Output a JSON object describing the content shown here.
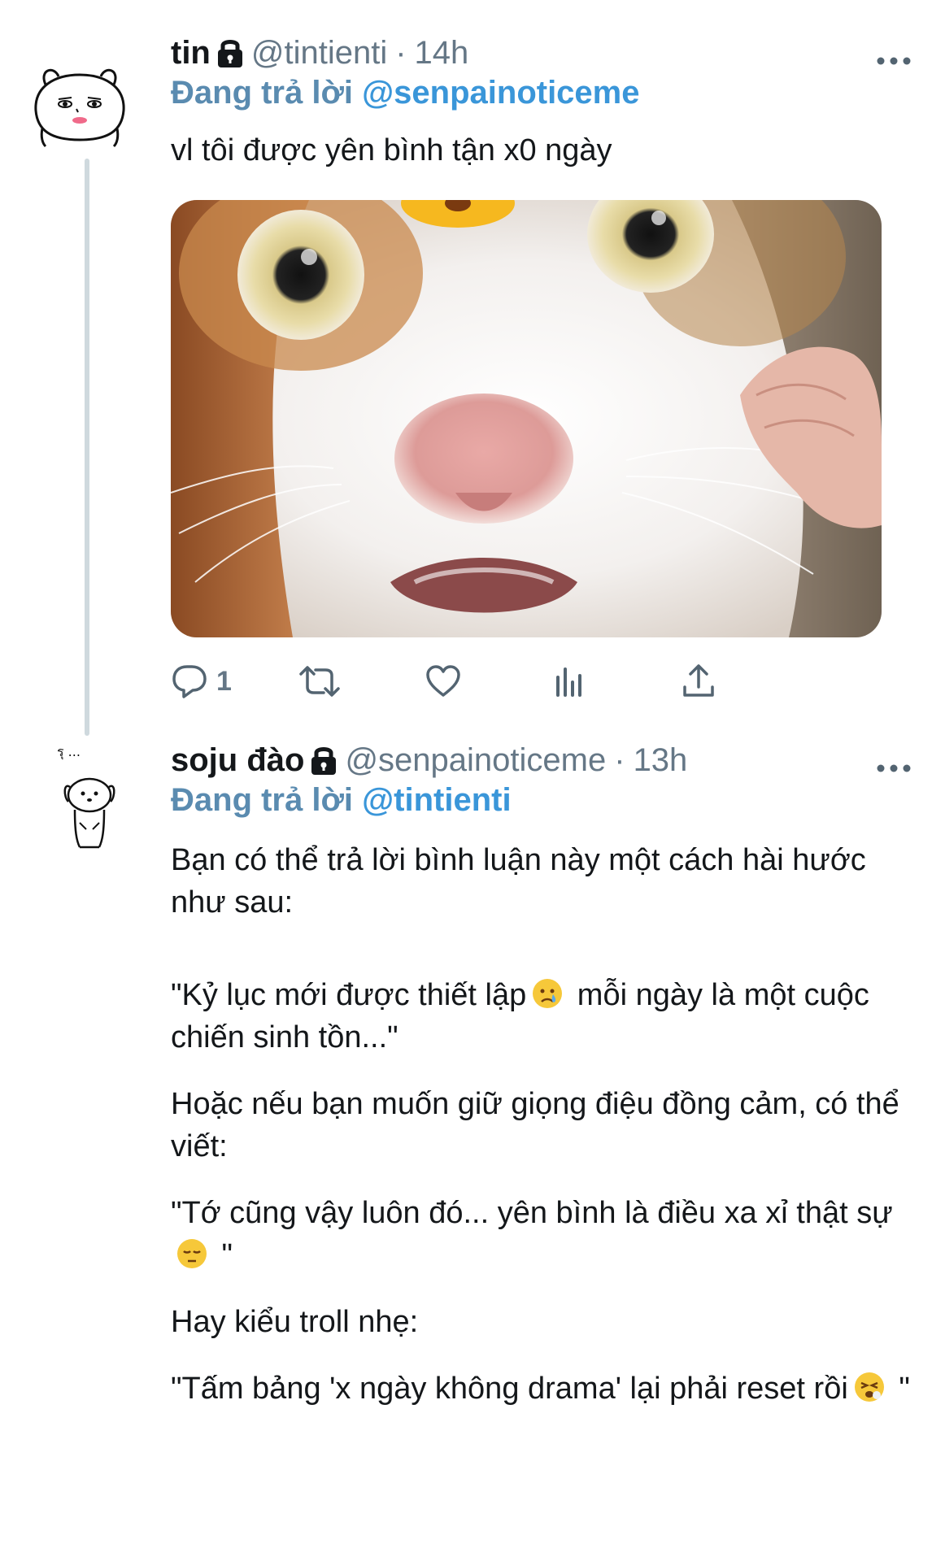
{
  "tweets": [
    {
      "display_name": "tin",
      "handle": "@tintienti",
      "separator": "·",
      "time": "14h",
      "replying_prefix": "Đang trả lời",
      "replying_to": "@senpainoticeme",
      "text": "vl tôi được yên bình tận x0 ngày",
      "media_alt": "cat-closeup-image",
      "actions": {
        "reply_count": "1"
      }
    },
    {
      "display_name": "soju đào",
      "handle": "@senpainoticeme",
      "separator": "·",
      "time": "13h",
      "replying_prefix": "Đang trả lời",
      "replying_to": "@tintienti",
      "paragraphs": {
        "p1": "Bạn có thể trả lời bình luận này một cách hài hước như sau:",
        "p2a": "\"Kỷ lục mới được thiết lập",
        "p2b": " mỗi ngày là một cuộc chiến sinh tồn...\"",
        "p3": "Hoặc nếu bạn muốn giữ giọng điệu đồng cảm, có thể viết:",
        "p4a": "\"Tớ cũng vậy luôn đó... yên bình là điều xa xỉ thật sự",
        "p4b": " \"",
        "p5": "Hay kiểu troll nhẹ:",
        "p6a": "\"Tấm bảng 'x ngày không drama' lại phải reset rồi",
        "p6b": " \""
      }
    }
  ],
  "avatar_2_caption": "รุ ...",
  "icons": {
    "more": "more-icon",
    "lock": "lock-icon",
    "reply": "reply-icon",
    "retweet": "retweet-icon",
    "like": "like-icon",
    "views": "views-icon",
    "share": "share-icon"
  },
  "colors": {
    "mention": "#3a96d9",
    "muted": "#657786",
    "thread_line": "#cfd9de"
  }
}
